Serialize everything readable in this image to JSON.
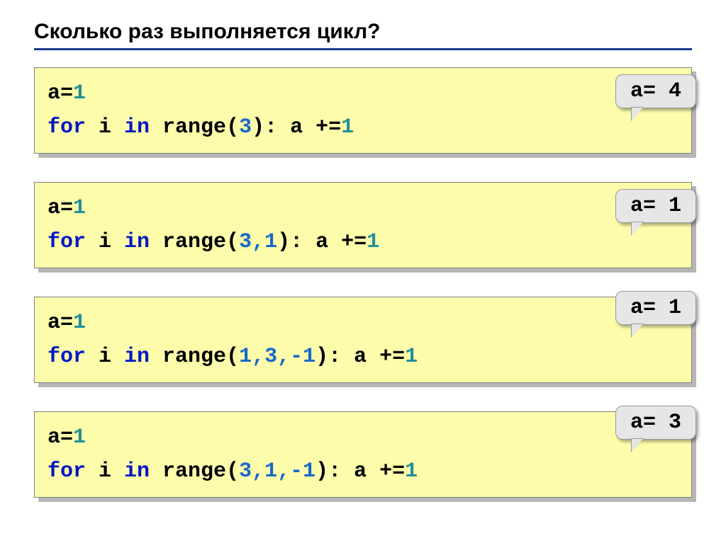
{
  "title": "Сколько раз выполняется цикл?",
  "blocks": [
    {
      "line1_pre": "a",
      "line1_eq": "=",
      "line1_val": "1",
      "line2_for": "for",
      "line2_var": " i ",
      "line2_in": "in",
      "line2_fn": " range(",
      "line2_args": "3",
      "line2_close": "): a +=",
      "line2_tail": "1",
      "answer_pre": "a",
      "answer_eq": "=",
      "answer_val": " 4"
    },
    {
      "line1_pre": "a",
      "line1_eq": "=",
      "line1_val": "1",
      "line2_for": "for",
      "line2_var": " i ",
      "line2_in": "in",
      "line2_fn": " range(",
      "line2_args": "3,1",
      "line2_close": "): a +=",
      "line2_tail": "1",
      "answer_pre": "a",
      "answer_eq": "=",
      "answer_val": " 1"
    },
    {
      "line1_pre": "a",
      "line1_eq": "=",
      "line1_val": "1",
      "line2_for": "for",
      "line2_var": " i ",
      "line2_in": "in",
      "line2_fn": " range(",
      "line2_args": "1,3,-1",
      "line2_close": "): a +=",
      "line2_tail": "1",
      "answer_pre": "a",
      "answer_eq": "=",
      "answer_val": " 1"
    },
    {
      "line1_pre": "a",
      "line1_eq": "=",
      "line1_val": "1",
      "line2_for": "for",
      "line2_var": " i ",
      "line2_in": "in",
      "line2_fn": " range(",
      "line2_args": "3,1,-1",
      "line2_close": "): a +=",
      "line2_tail": "1",
      "answer_pre": "a",
      "answer_eq": "=",
      "answer_val": " 3"
    }
  ]
}
